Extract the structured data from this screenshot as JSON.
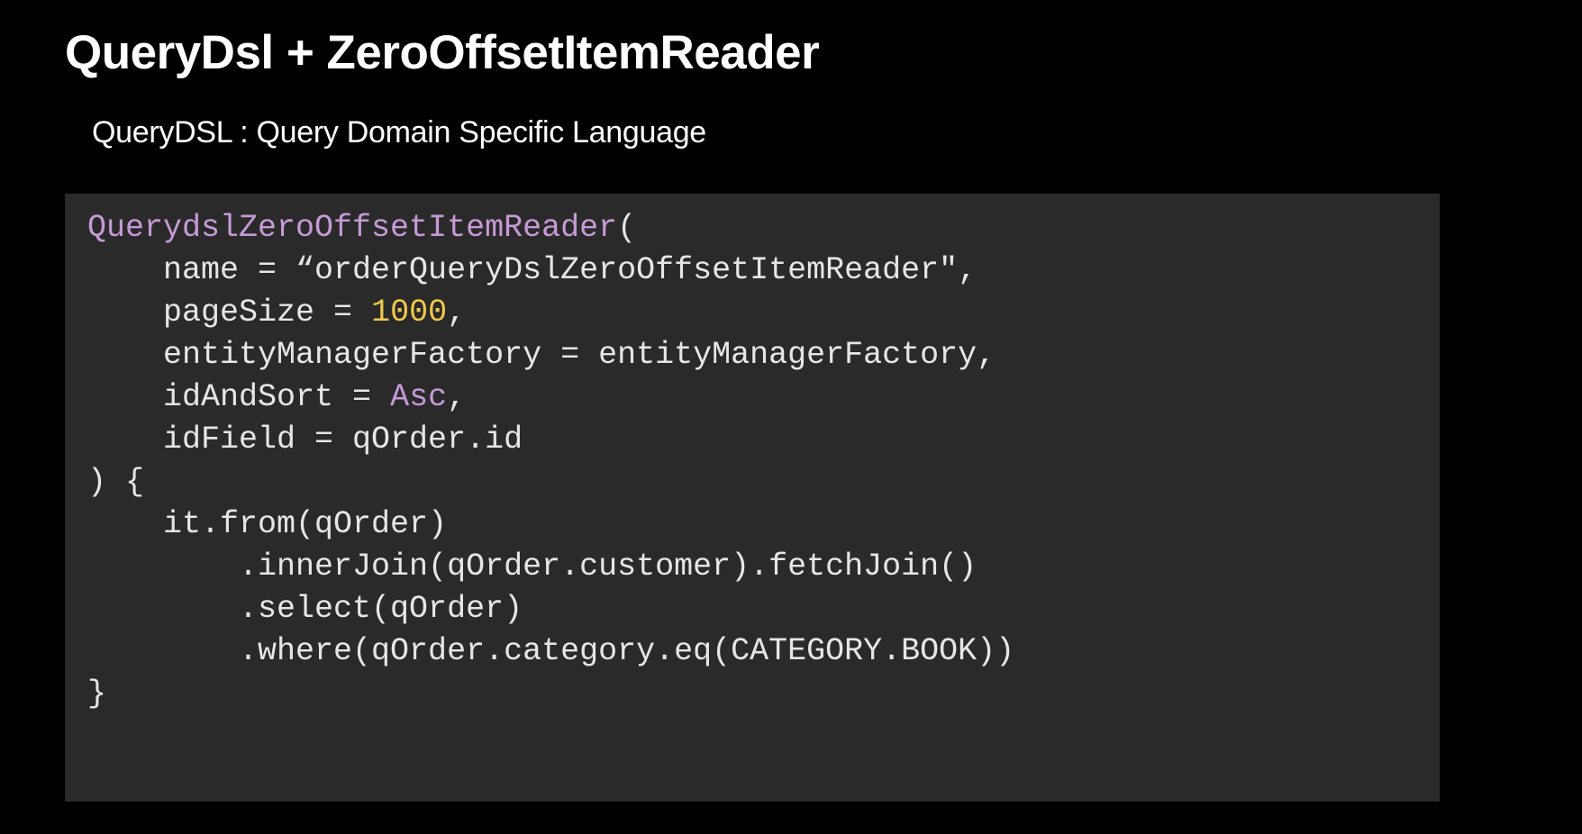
{
  "slide": {
    "title": "QueryDsl + ZeroOffsetItemReader",
    "subtitle": "QueryDSL : Query Domain Specific Language"
  },
  "code": {
    "lines": [
      [
        {
          "t": "QuerydslZeroOffsetItemReader",
          "c": "fn"
        },
        {
          "t": "(",
          "c": ""
        }
      ],
      [
        {
          "t": "    name = “orderQueryDslZeroOffsetItemReader\",",
          "c": ""
        }
      ],
      [
        {
          "t": "    pageSize = ",
          "c": ""
        },
        {
          "t": "1000",
          "c": "num"
        },
        {
          "t": ",",
          "c": ""
        }
      ],
      [
        {
          "t": "    entityManagerFactory = entityManagerFactory,",
          "c": ""
        }
      ],
      [
        {
          "t": "    idAndSort = ",
          "c": ""
        },
        {
          "t": "Asc",
          "c": "kw"
        },
        {
          "t": ",",
          "c": ""
        }
      ],
      [
        {
          "t": "    idField = qOrder.id",
          "c": ""
        }
      ],
      [
        {
          "t": ") {",
          "c": ""
        }
      ],
      [
        {
          "t": "    it.from(qOrder)",
          "c": ""
        }
      ],
      [
        {
          "t": "        .innerJoin(qOrder.customer).fetchJoin()",
          "c": ""
        }
      ],
      [
        {
          "t": "        .select(qOrder)",
          "c": ""
        }
      ],
      [
        {
          "t": "        .where(qOrder.category.eq(CATEGORY.BOOK))",
          "c": ""
        }
      ],
      [
        {
          "t": "}",
          "c": ""
        }
      ]
    ]
  },
  "colors": {
    "background": "#000000",
    "code_background": "#2a2a2a",
    "function": "#c69ad6",
    "number": "#f2c94c",
    "text": "#e6e6e6"
  }
}
